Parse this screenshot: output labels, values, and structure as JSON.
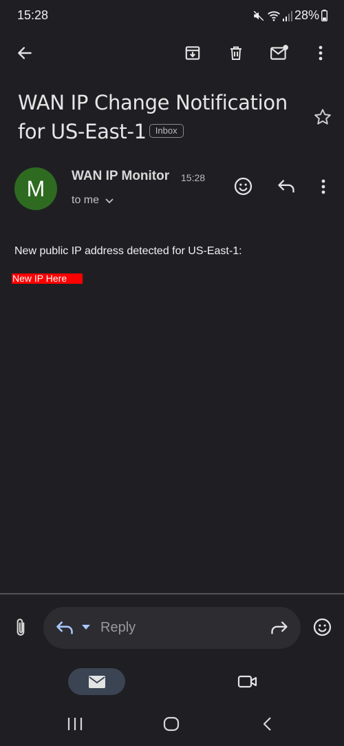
{
  "status_bar": {
    "time": "15:28",
    "battery": "28%",
    "icons": [
      "mute-icon",
      "wifi-icon",
      "signal-icon",
      "battery-icon"
    ]
  },
  "toolbar": {
    "icons": [
      "back-arrow-icon",
      "archive-icon",
      "delete-icon",
      "mark-unread-icon",
      "more-vert-icon"
    ]
  },
  "email": {
    "subject": "WAN IP Change Notification for US-East-1",
    "label": "Inbox",
    "sender": {
      "initial": "M",
      "name": "WAN IP Monitor",
      "time": "15:28",
      "recipient": "to me",
      "avatar_color": "#2e6b20"
    },
    "body": "New public IP address detected for US-East-1:",
    "highlight_text": "New IP Here",
    "highlight_color": "#ff0000"
  },
  "reply_bar": {
    "placeholder": "Reply"
  },
  "bottom_nav": {
    "items": [
      "mail-icon",
      "meet-video-icon"
    ]
  },
  "system_nav": {
    "items": [
      "recents-icon",
      "home-icon",
      "back-icon"
    ]
  }
}
